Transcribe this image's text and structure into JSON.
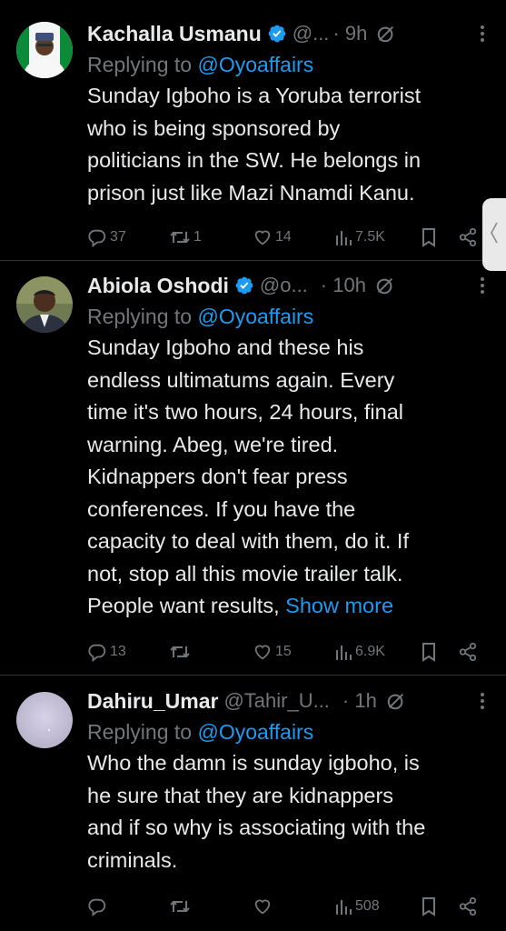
{
  "tweets": [
    {
      "name": "Kachalla Usmanu",
      "handle": "@...",
      "time": "· 9h",
      "replying_label": "Replying to ",
      "replying_to": "@Oyoaffairs",
      "text": "Sunday Igboho is a Yoruba terrorist\nwho is being sponsored by\npoliticians in the SW. He belongs in\nprison just like Mazi Nnamdi Kanu.",
      "show_more": "",
      "replies": "37",
      "retweets": "1",
      "likes": "14",
      "views": "7.5K"
    },
    {
      "name": "Abiola Oshodi",
      "handle": "@o...",
      "time": "· 10h",
      "replying_label": "Replying to ",
      "replying_to": "@Oyoaffairs",
      "text": "Sunday Igboho and these his\nendless ultimatums again. Every\ntime it's two hours, 24 hours, final\nwarning. Abeg, we're tired.\nKidnappers don't fear press\nconferences. If you have the\ncapacity to deal with them, do it. If\nnot, stop all this movie trailer talk.\nPeople want results, ",
      "show_more": "Show more",
      "replies": "13",
      "retweets": "",
      "likes": "15",
      "views": "6.9K"
    },
    {
      "name": "Dahiru_Umar",
      "handle": "@Tahir_U...",
      "time": "· 1h",
      "replying_label": "Replying to ",
      "replying_to": "@Oyoaffairs",
      "text": "Who the damn is sunday igboho, is\nhe sure that they are kidnappers\nand if so why is associating with the\ncriminals.",
      "show_more": "",
      "replies": "",
      "retweets": "",
      "likes": "",
      "views": "508"
    }
  ],
  "icons": {
    "verified": "verified-badge-icon",
    "grok": "grok-icon",
    "more": "more-options-icon",
    "reply": "reply-icon",
    "retweet": "retweet-icon",
    "like": "heart-icon",
    "views": "views-icon",
    "bookmark": "bookmark-icon",
    "share": "share-icon",
    "side": "chevron-left-icon"
  },
  "colors": {
    "background": "#000000",
    "text": "#e7e9ea",
    "muted": "#71767b",
    "link": "#1d9bf0",
    "divider": "#2f3336"
  }
}
